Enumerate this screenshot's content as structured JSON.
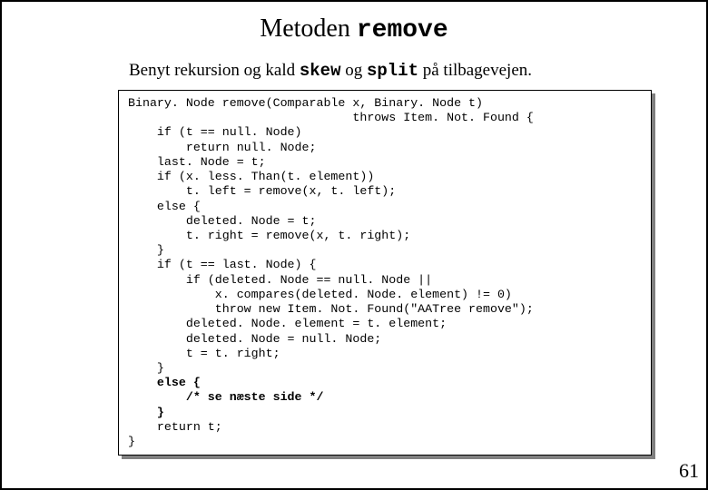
{
  "title_plain": "Metoden ",
  "title_mono": "remove",
  "subtitle_pre": "Benyt rekursion og kald ",
  "subtitle_m1": "skew",
  "subtitle_mid": " og ",
  "subtitle_m2": "split",
  "subtitle_post": " på tilbagevejen.",
  "code_l0": "Binary. Node remove(Comparable x, Binary. Node t)",
  "code_l1": "                               throws Item. Not. Found {",
  "code_l2": "    if (t == null. Node)",
  "code_l3": "        return null. Node;",
  "code_l4": "    last. Node = t;",
  "code_l5": "    if (x. less. Than(t. element))",
  "code_l6": "        t. left = remove(x, t. left);",
  "code_l7": "    else {",
  "code_l8": "        deleted. Node = t;",
  "code_l9": "        t. right = remove(x, t. right);",
  "code_l10": "    }",
  "code_l11": "    if (t == last. Node) {",
  "code_l12": "        if (deleted. Node == null. Node ||",
  "code_l13": "            x. compares(deleted. Node. element) != 0)",
  "code_l14": "            throw new Item. Not. Found(\"AATree remove\");",
  "code_l15": "        deleted. Node. element = t. element;",
  "code_l16": "        deleted. Node = null. Node;",
  "code_l17": "        t = t. right;",
  "code_l18": "    }",
  "code_l19a": "    else {",
  "code_l20a": "        /* se næste side */",
  "code_l21a": "    }",
  "code_l22": "    return t;",
  "code_l23": "}",
  "pagenum": "61"
}
